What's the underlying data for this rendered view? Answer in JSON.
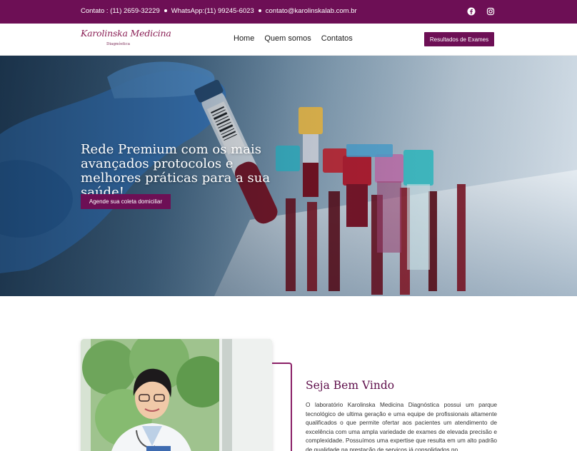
{
  "topbar": {
    "phone": "Contato : (11) 2659-32229",
    "whatsapp": "WhatsApp:(11) 99245-6023",
    "email": "contato@karolinskalab.com.br",
    "social": [
      "facebook-icon",
      "instagram-icon"
    ]
  },
  "brand": {
    "logo_script": "Karolinska Medicina",
    "logo_sub": "Diagnóstica",
    "primary_color": "#6d0f55"
  },
  "nav": {
    "items": [
      "Home",
      "Quem somos",
      "Contatos"
    ],
    "cta": "Resultados de Exames"
  },
  "hero": {
    "title": "Rede Premium com os mais avançados protocolos e melhores práticas para a sua saúde!",
    "button": "Agende sua coleta domiciliar"
  },
  "welcome": {
    "title": "Seja Bem Vindo",
    "text": "O laboratório Karolinska Medicina Diagnóstica possui um parque tecnológico de ultima geração e uma equipe de profissionais altamente qualificados o que permite ofertar aos pacientes um atendimento de excelência com uma ampla variedade de exames de elevada precisão e complexidade. Possuímos uma expertise que resulta em um alto padrão de qualidade na prestação de serviços já consolidados no"
  }
}
